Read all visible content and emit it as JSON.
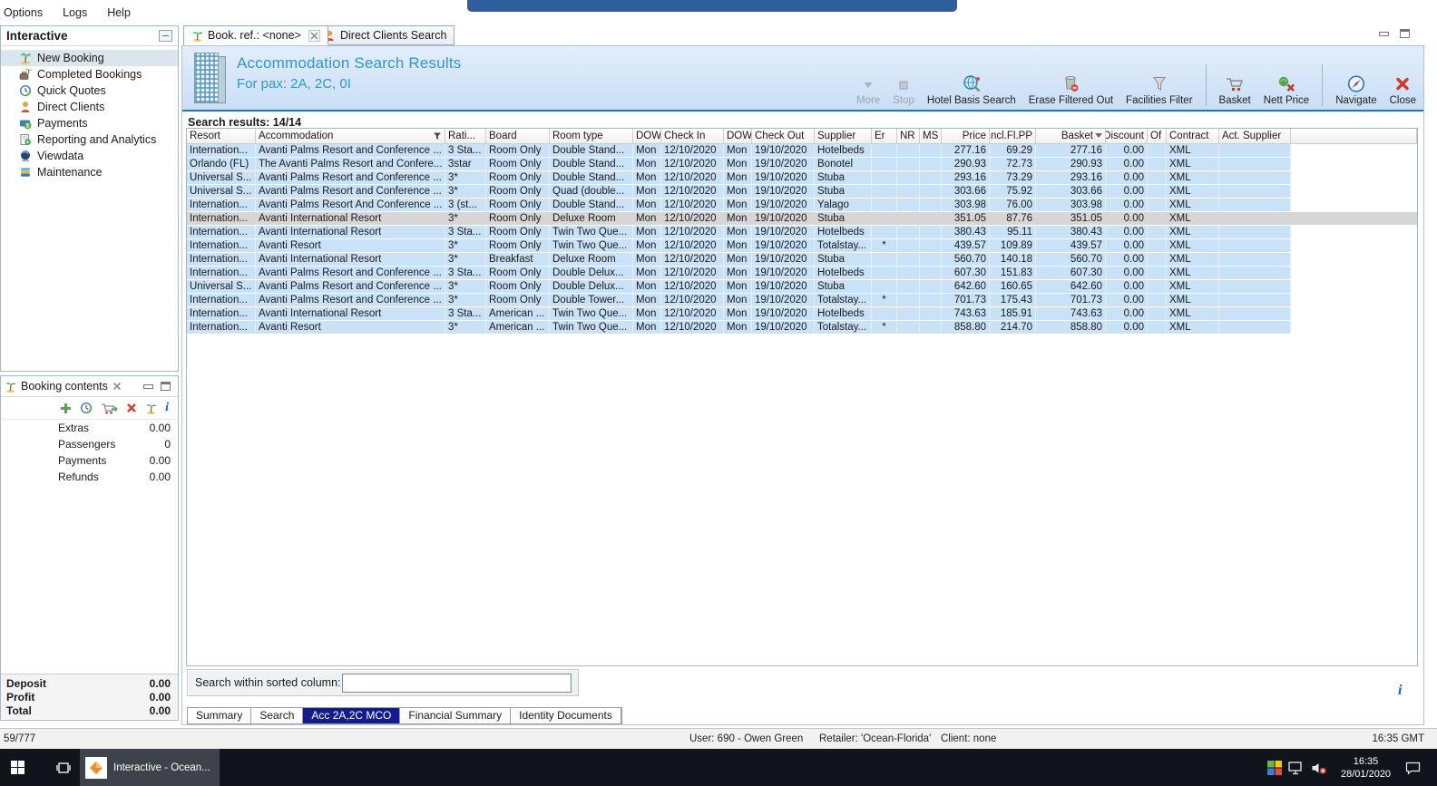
{
  "menu": {
    "items": [
      "Options",
      "Logs",
      "Help"
    ]
  },
  "sidebar": {
    "title": "Interactive",
    "items": [
      {
        "label": "New Booking",
        "selected": true
      },
      {
        "label": "Completed Bookings"
      },
      {
        "label": "Quick Quotes"
      },
      {
        "label": "Direct Clients"
      },
      {
        "label": "Payments"
      },
      {
        "label": "Reporting and Analytics"
      },
      {
        "label": "Viewdata"
      },
      {
        "label": "Maintenance"
      }
    ]
  },
  "tabs": [
    {
      "label": "Book. ref.: <none>",
      "closable": true,
      "active": true
    },
    {
      "label": "Direct Clients Search",
      "active": false
    }
  ],
  "banner": {
    "title": "Accommodation Search Results",
    "subtitle": "For pax: 2A, 2C, 0I"
  },
  "toolbar": {
    "items": [
      {
        "label": "More",
        "disabled": true
      },
      {
        "label": "Stop",
        "disabled": true
      },
      {
        "label": "Hotel Basis Search"
      },
      {
        "label": "Erase Filtered Out"
      },
      {
        "label": "Facilities Filter"
      },
      {
        "label": "Basket"
      },
      {
        "label": "Nett Price"
      },
      {
        "label": "Navigate"
      },
      {
        "label": "Close"
      }
    ]
  },
  "results": {
    "summary": "Search results: 14/14",
    "columns": [
      "Resort",
      "Accommodation",
      "Rati...",
      "Board",
      "Room type",
      "DOW",
      "Check In",
      "DOW",
      "Check Out",
      "Supplier",
      "Er",
      "NR",
      "MS",
      "Price",
      "Incl.Fl.PP",
      "Basket",
      "Discount",
      "Of",
      "Contract",
      "Act. Supplier"
    ],
    "filter_column_index": 1,
    "sorted_column_index": 15,
    "selected_row_index": 5,
    "rows": [
      [
        "Internation...",
        "Avanti Palms Resort and Conference ...",
        "3 Sta...",
        "Room Only",
        "Double Stand...",
        "Mon",
        "12/10/2020",
        "Mon",
        "19/10/2020",
        "Hotelbeds",
        "",
        "",
        "",
        "277.16",
        "69.29",
        "277.16",
        "0.00",
        "",
        "XML",
        ""
      ],
      [
        "Orlando (FL)",
        "The Avanti Palms Resort and Confere...",
        "3star",
        "Room Only",
        "Double Stand...",
        "Mon",
        "12/10/2020",
        "Mon",
        "19/10/2020",
        "Bonotel",
        "",
        "",
        "",
        "290.93",
        "72.73",
        "290.93",
        "0.00",
        "",
        "XML",
        ""
      ],
      [
        "Universal S...",
        "Avanti Palms Resort and Conference ...",
        "3*",
        "Room Only",
        "Double Stand...",
        "Mon",
        "12/10/2020",
        "Mon",
        "19/10/2020",
        "Stuba",
        "",
        "",
        "",
        "293.16",
        "73.29",
        "293.16",
        "0.00",
        "",
        "XML",
        ""
      ],
      [
        "Universal S...",
        "Avanti Palms Resort and Conference ...",
        "3*",
        "Room Only",
        "Quad (double...",
        "Mon",
        "12/10/2020",
        "Mon",
        "19/10/2020",
        "Stuba",
        "",
        "",
        "",
        "303.66",
        "75.92",
        "303.66",
        "0.00",
        "",
        "XML",
        ""
      ],
      [
        "Internation...",
        "Avanti Palms Resort And Conference ...",
        "3 (st...",
        "Room Only",
        "Double Stand...",
        "Mon",
        "12/10/2020",
        "Mon",
        "19/10/2020",
        "Yalago",
        "",
        "",
        "",
        "303.98",
        "76.00",
        "303.98",
        "0.00",
        "",
        "XML",
        ""
      ],
      [
        "Internation...",
        "Avanti International Resort",
        "3*",
        "Room Only",
        "Deluxe Room",
        "Mon",
        "12/10/2020",
        "Mon",
        "19/10/2020",
        "Stuba",
        "",
        "",
        "",
        "351.05",
        "87.76",
        "351.05",
        "0.00",
        "",
        "XML",
        ""
      ],
      [
        "Internation...",
        "Avanti International Resort",
        "3 Sta...",
        "Room Only",
        "Twin Two Que...",
        "Mon",
        "12/10/2020",
        "Mon",
        "19/10/2020",
        "Hotelbeds",
        "",
        "",
        "",
        "380.43",
        "95.11",
        "380.43",
        "0.00",
        "",
        "XML",
        ""
      ],
      [
        "Internation...",
        "Avanti Resort",
        "3*",
        "Room Only",
        "Twin Two Que...",
        "Mon",
        "12/10/2020",
        "Mon",
        "19/10/2020",
        "Totalstay...",
        "*",
        "",
        "",
        "439.57",
        "109.89",
        "439.57",
        "0.00",
        "",
        "XML",
        ""
      ],
      [
        "Internation...",
        "Avanti International Resort",
        "3*",
        "Breakfast",
        "Deluxe Room",
        "Mon",
        "12/10/2020",
        "Mon",
        "19/10/2020",
        "Stuba",
        "",
        "",
        "",
        "560.70",
        "140.18",
        "560.70",
        "0.00",
        "",
        "XML",
        ""
      ],
      [
        "Internation...",
        "Avanti Palms Resort and Conference ...",
        "3 Sta...",
        "Room Only",
        "Double Delux...",
        "Mon",
        "12/10/2020",
        "Mon",
        "19/10/2020",
        "Hotelbeds",
        "",
        "",
        "",
        "607.30",
        "151.83",
        "607.30",
        "0.00",
        "",
        "XML",
        ""
      ],
      [
        "Universal S...",
        "Avanti Palms Resort and Conference ...",
        "3*",
        "Room Only",
        "Double Delux...",
        "Mon",
        "12/10/2020",
        "Mon",
        "19/10/2020",
        "Stuba",
        "",
        "",
        "",
        "642.60",
        "160.65",
        "642.60",
        "0.00",
        "",
        "XML",
        ""
      ],
      [
        "Internation...",
        "Avanti Palms Resort and Conference ...",
        "3*",
        "Room Only",
        "Double Tower...",
        "Mon",
        "12/10/2020",
        "Mon",
        "19/10/2020",
        "Totalstay...",
        "*",
        "",
        "",
        "701.73",
        "175.43",
        "701.73",
        "0.00",
        "",
        "XML",
        ""
      ],
      [
        "Internation...",
        "Avanti International Resort",
        "3 Sta...",
        "American ...",
        "Twin Two Que...",
        "Mon",
        "12/10/2020",
        "Mon",
        "19/10/2020",
        "Hotelbeds",
        "",
        "",
        "",
        "743.63",
        "185.91",
        "743.63",
        "0.00",
        "",
        "XML",
        ""
      ],
      [
        "Internation...",
        "Avanti Resort",
        "3*",
        "American ...",
        "Twin Two Que...",
        "Mon",
        "12/10/2020",
        "Mon",
        "19/10/2020",
        "Totalstay...",
        "*",
        "",
        "",
        "858.80",
        "214.70",
        "858.80",
        "0.00",
        "",
        "XML",
        ""
      ]
    ]
  },
  "search_box": {
    "label": "Search within sorted column:",
    "value": ""
  },
  "bottom_tabs": {
    "active_index": 2,
    "items": [
      "Summary",
      "Search",
      "Acc 2A,2C MCO",
      "Financial Summary",
      "Identity Documents"
    ]
  },
  "booking_contents": {
    "title": "Booking contents",
    "rows": [
      {
        "label": "Extras",
        "value": "0.00"
      },
      {
        "label": "Passengers",
        "value": "0"
      },
      {
        "label": "Payments",
        "value": "0.00"
      },
      {
        "label": "Refunds",
        "value": "0.00"
      }
    ],
    "summary": [
      {
        "label": "Deposit",
        "value": "0.00"
      },
      {
        "label": "Profit",
        "value": "0.00"
      },
      {
        "label": "Total",
        "value": "0.00"
      }
    ]
  },
  "status_bar": {
    "counter": "59/777",
    "user": "User: 690 - Owen Green",
    "retailer": "Retailer: 'Ocean-Florida'",
    "client": "Client: none",
    "time": "16:35 GMT"
  },
  "taskbar": {
    "app_label": "Interactive - Ocean...",
    "time": "16:35",
    "date": "28/01/2020"
  }
}
